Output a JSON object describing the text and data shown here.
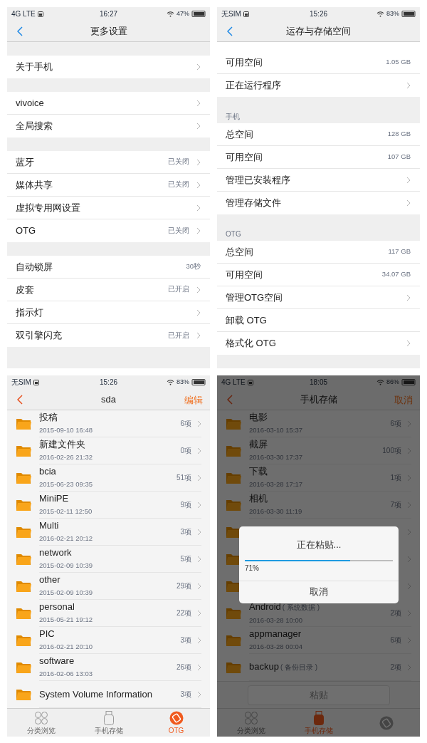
{
  "panels": [
    {
      "kind": "settings",
      "scrolled": false,
      "status_bar": {
        "carrier": "4G LTE",
        "time": "16:27",
        "battery": "47%"
      },
      "header": {
        "title": "更多设置"
      },
      "sections": [
        {
          "rows": [
            {
              "label": "关于手机",
              "chevron": true
            }
          ]
        },
        {
          "rows": [
            {
              "label": "vivoice",
              "chevron": true
            },
            {
              "label": "全局搜索",
              "chevron": true
            }
          ]
        },
        {
          "rows": [
            {
              "label": "蓝牙",
              "value": "已关闭",
              "chevron": true
            },
            {
              "label": "媒体共享",
              "value": "已关闭",
              "chevron": true
            },
            {
              "label": "虚拟专用网设置",
              "chevron": true
            },
            {
              "label": "OTG",
              "value": "已关闭",
              "chevron": true
            }
          ]
        },
        {
          "rows": [
            {
              "label": "自动锁屏",
              "value": "30秒",
              "chevron": false
            },
            {
              "label": "皮套",
              "value": "已开启",
              "chevron": true
            },
            {
              "label": "指示灯",
              "chevron": true
            },
            {
              "label": "双引擎闪充",
              "value": "已开启",
              "chevron": true
            }
          ]
        }
      ]
    },
    {
      "kind": "settings",
      "scrolled": true,
      "status_bar": {
        "carrier": "无SIM",
        "time": "15:26",
        "battery": "83%"
      },
      "header": {
        "title": "运存与存储空间"
      },
      "sections": [
        {
          "rows": [
            {
              "label": "可用空间",
              "value": "1.05 GB",
              "chevron": false
            },
            {
              "label": "正在运行程序",
              "chevron": true
            }
          ]
        },
        {
          "header": "手机",
          "rows": [
            {
              "label": "总空间",
              "value": "128 GB",
              "chevron": false
            },
            {
              "label": "可用空间",
              "value": "107 GB",
              "chevron": false
            },
            {
              "label": "管理已安装程序",
              "chevron": true
            },
            {
              "label": "管理存储文件",
              "chevron": true
            }
          ]
        },
        {
          "header": "OTG",
          "rows": [
            {
              "label": "总空间",
              "value": "117 GB",
              "chevron": false
            },
            {
              "label": "可用空间",
              "value": "34.07 GB",
              "chevron": false
            },
            {
              "label": "管理OTG空间",
              "chevron": true
            },
            {
              "label": "卸载 OTG",
              "chevron": false
            },
            {
              "label": "格式化 OTG",
              "chevron": true
            }
          ]
        }
      ]
    },
    {
      "kind": "files",
      "status_bar": {
        "carrier": "无SIM",
        "time": "15:26",
        "battery": "83%"
      },
      "header": {
        "title": "sda",
        "action": "编辑"
      },
      "files": [
        {
          "name": "投稿",
          "date": "2015-09-10 16:48",
          "count": "6项"
        },
        {
          "name": "新建文件夹",
          "date": "2016-02-26 21:32",
          "count": "0项"
        },
        {
          "name": "bcia",
          "date": "2015-06-23 09:35",
          "count": "51项"
        },
        {
          "name": "MiniPE",
          "date": "2015-02-11 12:50",
          "count": "9项"
        },
        {
          "name": "Multi",
          "date": "2016-02-21 20:12",
          "count": "3项"
        },
        {
          "name": "network",
          "date": "2015-02-09 10:39",
          "count": "5项"
        },
        {
          "name": "other",
          "date": "2015-02-09 10:39",
          "count": "29项"
        },
        {
          "name": "personal",
          "date": "2015-05-21 19:12",
          "count": "22项"
        },
        {
          "name": "PIC",
          "date": "2016-02-21 20:10",
          "count": "3项"
        },
        {
          "name": "software",
          "date": "2016-02-06 13:03",
          "count": "26项"
        },
        {
          "name": "System Volume Information",
          "count": "3项"
        }
      ],
      "tabs": [
        {
          "kind": "grid",
          "label": "分类浏览",
          "selected": false
        },
        {
          "kind": "usb",
          "label": "手机存储",
          "selected": false
        },
        {
          "kind": "otg",
          "label": "OTG",
          "selected": true
        }
      ]
    },
    {
      "kind": "files",
      "status_bar": {
        "carrier": "4G LTE",
        "time": "18:05",
        "battery": "86%"
      },
      "header": {
        "title": "手机存储",
        "action": "取消"
      },
      "files": [
        {
          "kind": "folder",
          "name": "电影",
          "date": "2016-03-10 15:37",
          "count": "6项"
        },
        {
          "name": "截屏",
          "date": "2016-03-30 17:37",
          "count": "100项"
        },
        {
          "name": "下载",
          "date": "2016-03-28 17:17",
          "count": "1项"
        },
        {
          "name": "相机",
          "date": "2016-03-30 11:19",
          "count": "7项"
        },
        {
          "kind": "covered"
        },
        {
          "kind": "covered"
        },
        {
          "kind": "covered"
        },
        {
          "name": "Android",
          "note": "( 系统数据 )",
          "date": "2016-03-28 10:00",
          "count": "2项"
        },
        {
          "name": "appmanager",
          "date": "2016-03-28 00:04",
          "count": "6项"
        },
        {
          "name": "backup",
          "note": "( 备份目录 )",
          "count": "2项"
        }
      ],
      "paste_button": "粘贴",
      "tabs": [
        {
          "kind": "grid",
          "label": "分类浏览",
          "selected": false
        },
        {
          "kind": "usb",
          "label": "手机存储",
          "selected": true
        },
        {
          "kind": "otg",
          "selected": false
        }
      ],
      "dialog": {
        "title": "正在粘贴...",
        "level": 0.71,
        "percent": "71%",
        "button": "取消"
      }
    }
  ]
}
